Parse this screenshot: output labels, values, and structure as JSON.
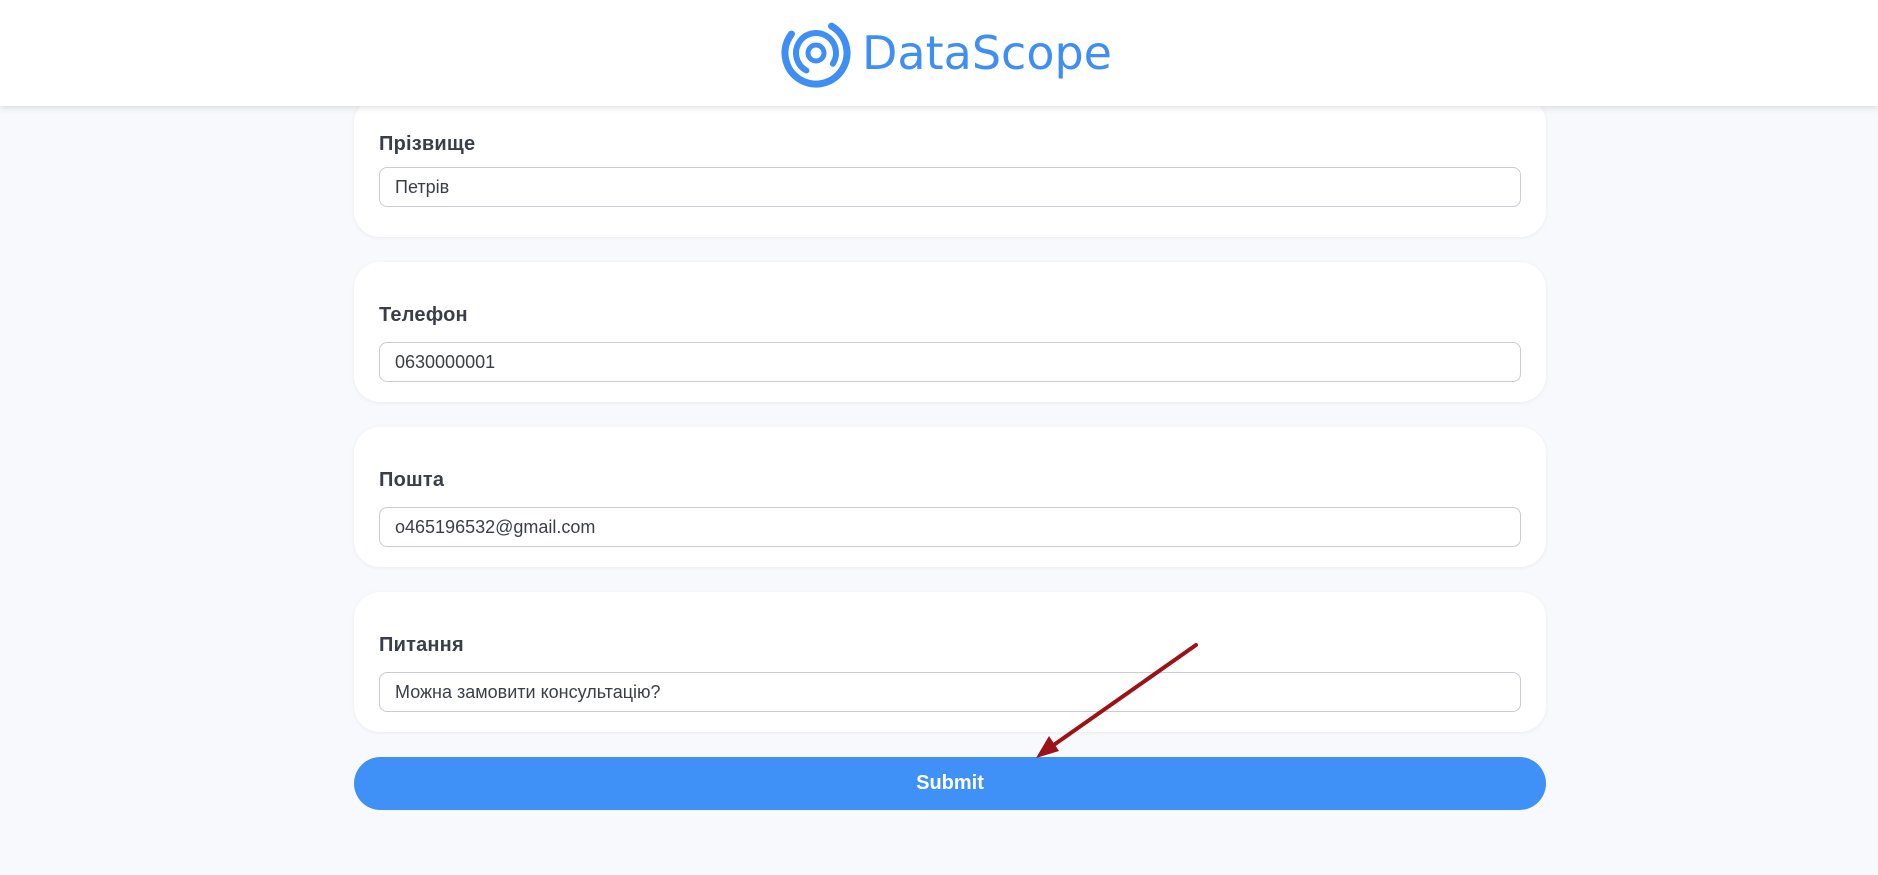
{
  "header": {
    "logo_text": "DataScope",
    "logo_icon": "concentric-rings-logo-icon",
    "brand_color": "#3e8ef4"
  },
  "form": {
    "fields": [
      {
        "label": "Прізвище",
        "value": "Петрів"
      },
      {
        "label": "Телефон",
        "value": "0630000001"
      },
      {
        "label": "Пошта",
        "value": "o465196532@gmail.com"
      },
      {
        "label": "Питання",
        "value": "Можна замовити консультацію?"
      }
    ],
    "submit_label": "Submit",
    "submit_color": "#3f91f7"
  },
  "annotation": {
    "arrow_color": "#9b1217"
  }
}
